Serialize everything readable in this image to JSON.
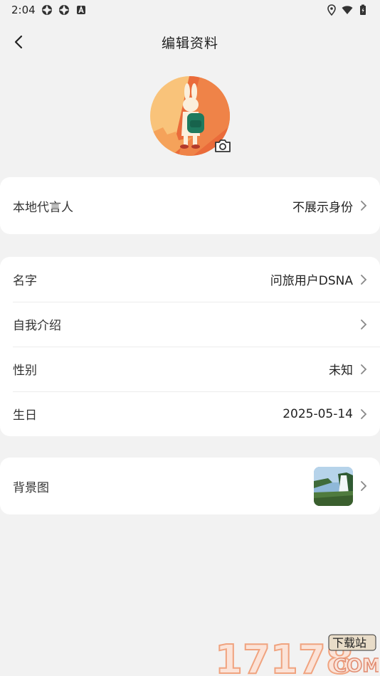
{
  "status_bar": {
    "time": "2:04"
  },
  "header": {
    "title": "编辑资料"
  },
  "card_spokesperson": {
    "label": "本地代言人",
    "value": "不展示身份"
  },
  "profile": {
    "name_label": "名字",
    "name_value": "问旅用户DSNA",
    "intro_label": "自我介绍",
    "intro_value": "",
    "gender_label": "性别",
    "gender_value": "未知",
    "birthday_label": "生日",
    "birthday_value": "2025-05-14"
  },
  "background": {
    "label": "背景图"
  },
  "watermark": {
    "number": "17178",
    "tag": "下载站",
    "domain": "COM"
  },
  "icons": {
    "back": "chevron-left-icon",
    "camera": "camera-icon",
    "chevron": "chevron-right-icon",
    "location": "location-icon",
    "wifi": "wifi-icon",
    "battery": "battery-icon"
  },
  "colors": {
    "avatar_bg": "#f9c37a",
    "avatar_accent": "#ea6b3a",
    "backpack": "#1f7a5e"
  }
}
